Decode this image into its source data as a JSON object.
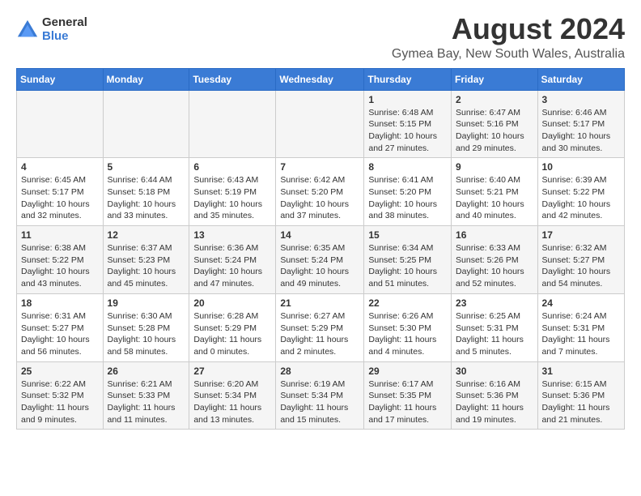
{
  "logo": {
    "general": "General",
    "blue": "Blue"
  },
  "title": "August 2024",
  "subtitle": "Gymea Bay, New South Wales, Australia",
  "days_of_week": [
    "Sunday",
    "Monday",
    "Tuesday",
    "Wednesday",
    "Thursday",
    "Friday",
    "Saturday"
  ],
  "weeks": [
    [
      {
        "day": "",
        "info": ""
      },
      {
        "day": "",
        "info": ""
      },
      {
        "day": "",
        "info": ""
      },
      {
        "day": "",
        "info": ""
      },
      {
        "day": "1",
        "info": "Sunrise: 6:48 AM\nSunset: 5:15 PM\nDaylight: 10 hours\nand 27 minutes."
      },
      {
        "day": "2",
        "info": "Sunrise: 6:47 AM\nSunset: 5:16 PM\nDaylight: 10 hours\nand 29 minutes."
      },
      {
        "day": "3",
        "info": "Sunrise: 6:46 AM\nSunset: 5:17 PM\nDaylight: 10 hours\nand 30 minutes."
      }
    ],
    [
      {
        "day": "4",
        "info": "Sunrise: 6:45 AM\nSunset: 5:17 PM\nDaylight: 10 hours\nand 32 minutes."
      },
      {
        "day": "5",
        "info": "Sunrise: 6:44 AM\nSunset: 5:18 PM\nDaylight: 10 hours\nand 33 minutes."
      },
      {
        "day": "6",
        "info": "Sunrise: 6:43 AM\nSunset: 5:19 PM\nDaylight: 10 hours\nand 35 minutes."
      },
      {
        "day": "7",
        "info": "Sunrise: 6:42 AM\nSunset: 5:20 PM\nDaylight: 10 hours\nand 37 minutes."
      },
      {
        "day": "8",
        "info": "Sunrise: 6:41 AM\nSunset: 5:20 PM\nDaylight: 10 hours\nand 38 minutes."
      },
      {
        "day": "9",
        "info": "Sunrise: 6:40 AM\nSunset: 5:21 PM\nDaylight: 10 hours\nand 40 minutes."
      },
      {
        "day": "10",
        "info": "Sunrise: 6:39 AM\nSunset: 5:22 PM\nDaylight: 10 hours\nand 42 minutes."
      }
    ],
    [
      {
        "day": "11",
        "info": "Sunrise: 6:38 AM\nSunset: 5:22 PM\nDaylight: 10 hours\nand 43 minutes."
      },
      {
        "day": "12",
        "info": "Sunrise: 6:37 AM\nSunset: 5:23 PM\nDaylight: 10 hours\nand 45 minutes."
      },
      {
        "day": "13",
        "info": "Sunrise: 6:36 AM\nSunset: 5:24 PM\nDaylight: 10 hours\nand 47 minutes."
      },
      {
        "day": "14",
        "info": "Sunrise: 6:35 AM\nSunset: 5:24 PM\nDaylight: 10 hours\nand 49 minutes."
      },
      {
        "day": "15",
        "info": "Sunrise: 6:34 AM\nSunset: 5:25 PM\nDaylight: 10 hours\nand 51 minutes."
      },
      {
        "day": "16",
        "info": "Sunrise: 6:33 AM\nSunset: 5:26 PM\nDaylight: 10 hours\nand 52 minutes."
      },
      {
        "day": "17",
        "info": "Sunrise: 6:32 AM\nSunset: 5:27 PM\nDaylight: 10 hours\nand 54 minutes."
      }
    ],
    [
      {
        "day": "18",
        "info": "Sunrise: 6:31 AM\nSunset: 5:27 PM\nDaylight: 10 hours\nand 56 minutes."
      },
      {
        "day": "19",
        "info": "Sunrise: 6:30 AM\nSunset: 5:28 PM\nDaylight: 10 hours\nand 58 minutes."
      },
      {
        "day": "20",
        "info": "Sunrise: 6:28 AM\nSunset: 5:29 PM\nDaylight: 11 hours\nand 0 minutes."
      },
      {
        "day": "21",
        "info": "Sunrise: 6:27 AM\nSunset: 5:29 PM\nDaylight: 11 hours\nand 2 minutes."
      },
      {
        "day": "22",
        "info": "Sunrise: 6:26 AM\nSunset: 5:30 PM\nDaylight: 11 hours\nand 4 minutes."
      },
      {
        "day": "23",
        "info": "Sunrise: 6:25 AM\nSunset: 5:31 PM\nDaylight: 11 hours\nand 5 minutes."
      },
      {
        "day": "24",
        "info": "Sunrise: 6:24 AM\nSunset: 5:31 PM\nDaylight: 11 hours\nand 7 minutes."
      }
    ],
    [
      {
        "day": "25",
        "info": "Sunrise: 6:22 AM\nSunset: 5:32 PM\nDaylight: 11 hours\nand 9 minutes."
      },
      {
        "day": "26",
        "info": "Sunrise: 6:21 AM\nSunset: 5:33 PM\nDaylight: 11 hours\nand 11 minutes."
      },
      {
        "day": "27",
        "info": "Sunrise: 6:20 AM\nSunset: 5:34 PM\nDaylight: 11 hours\nand 13 minutes."
      },
      {
        "day": "28",
        "info": "Sunrise: 6:19 AM\nSunset: 5:34 PM\nDaylight: 11 hours\nand 15 minutes."
      },
      {
        "day": "29",
        "info": "Sunrise: 6:17 AM\nSunset: 5:35 PM\nDaylight: 11 hours\nand 17 minutes."
      },
      {
        "day": "30",
        "info": "Sunrise: 6:16 AM\nSunset: 5:36 PM\nDaylight: 11 hours\nand 19 minutes."
      },
      {
        "day": "31",
        "info": "Sunrise: 6:15 AM\nSunset: 5:36 PM\nDaylight: 11 hours\nand 21 minutes."
      }
    ]
  ]
}
